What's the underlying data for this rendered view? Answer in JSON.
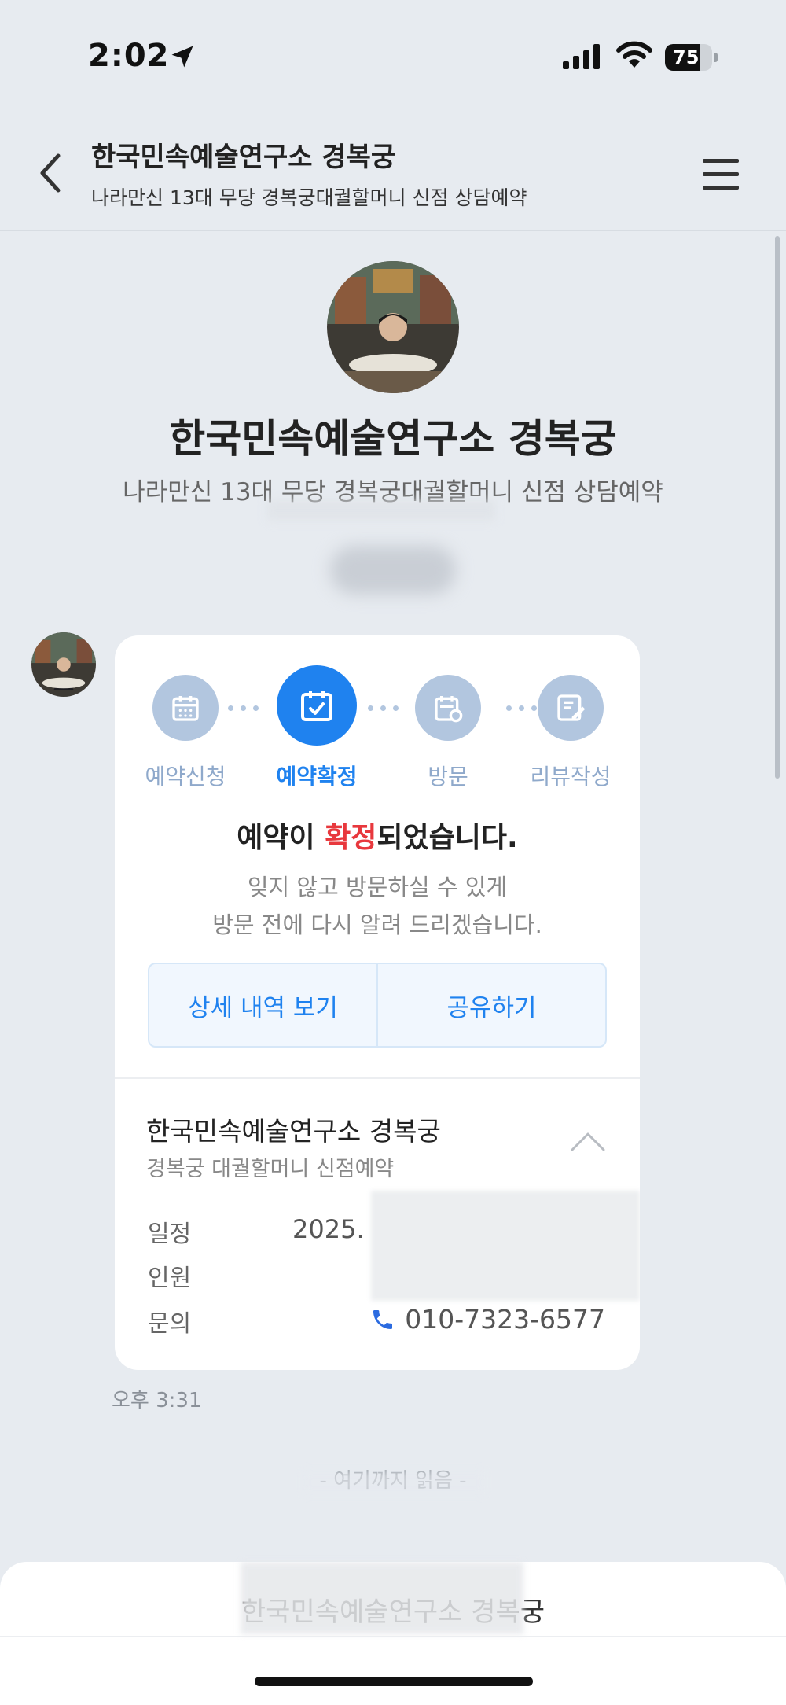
{
  "status_bar": {
    "time": "2:02",
    "battery": "75",
    "battery_level": 0.75
  },
  "header": {
    "title": "한국민속예술연구소 경복궁",
    "subtitle": "나라만신 13대 무당 경복궁대궐할머니 신점 상담예약"
  },
  "profile": {
    "name": "한국민속예술연구소 경복궁",
    "description": "나라만신 13대 무당 경복궁대궐할머니 신점 상담예약"
  },
  "card": {
    "steps": [
      {
        "label": "예약신청",
        "icon": "calendar-icon",
        "active": false
      },
      {
        "label": "예약확정",
        "icon": "calendar-check-icon",
        "active": true
      },
      {
        "label": "방문",
        "icon": "visit-icon",
        "active": false
      },
      {
        "label": "리뷰작성",
        "icon": "review-edit-icon",
        "active": false
      }
    ],
    "confirm_prefix": "예약이 ",
    "confirm_highlight": "확정",
    "confirm_suffix": "되었습니다.",
    "confirm_desc_line1": "잊지 않고 방문하실 수 있게",
    "confirm_desc_line2": "방문 전에 다시 알려 드리겠습니다.",
    "details_button": "상세 내역 보기",
    "share_button": "공유하기",
    "shop_name": "한국민속예술연구소 경복궁",
    "shop_sub": "경복궁 대궐할머니 신점예약",
    "info": {
      "schedule_label": "일정",
      "schedule_value": "2025.",
      "people_label": "인원",
      "contact_label": "문의",
      "phone": "010-7323-6577"
    }
  },
  "message_time": "오후 3:31",
  "read_marker": "- 여기까지 읽음 -",
  "bottom": {
    "name": "한국민속예술연구소 경복궁"
  },
  "colors": {
    "accent": "#1f82ef",
    "highlight": "#e8383d",
    "background": "#e7ebf0",
    "step_inactive": "#b2c6df"
  }
}
